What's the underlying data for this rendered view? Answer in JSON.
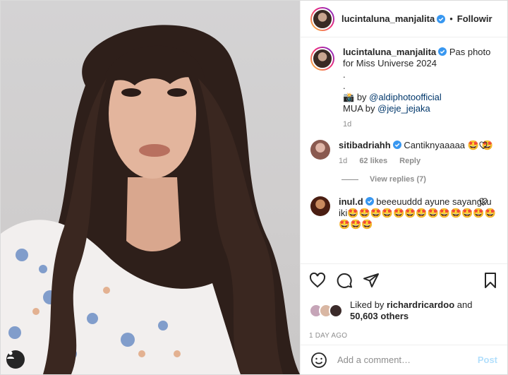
{
  "colors": {
    "accent": "#0095f6",
    "verified": "#3897f0",
    "muted": "#8e8e8e",
    "link": "#00376b"
  },
  "header": {
    "username": "lucintaluna_manjalita",
    "separator": "•",
    "follow_label": "Followir"
  },
  "caption": {
    "username": "lucintaluna_manjalita",
    "text": "Pas photo for Miss Universe 2024",
    "dot1": ".",
    "dot2": ".",
    "camera_emoji": "📸",
    "by_label": "by",
    "photographer": "@aldiphotoofficial",
    "mua_label": "MUA by",
    "mua": "@jeje_jejaka",
    "time": "1d"
  },
  "comments": [
    {
      "username": "sitibadriahh",
      "text": "Cantiknyaaaaa 🤩 🤩",
      "time": "1d",
      "likes": "62 likes",
      "reply_label": "Reply",
      "view_replies": "View replies (7)"
    },
    {
      "username": "inul.d",
      "text": "beeeuuddd ayune sayangku iki🤩🤩🤩🤩🤩🤩🤩🤩🤩🤩🤩🤩🤩🤩🤩🤩"
    }
  ],
  "icons": [
    "heart-icon",
    "comment-icon",
    "share-icon",
    "bookmark-icon",
    "smiley-icon",
    "user-tag-icon",
    "verified-icon"
  ],
  "likes": {
    "prefix": "Liked by",
    "user": "richardricardoo",
    "and": "and",
    "count": "50,603 others"
  },
  "date": "1 DAY AGO",
  "add_comment": {
    "placeholder": "Add a comment…",
    "post_label": "Post"
  }
}
